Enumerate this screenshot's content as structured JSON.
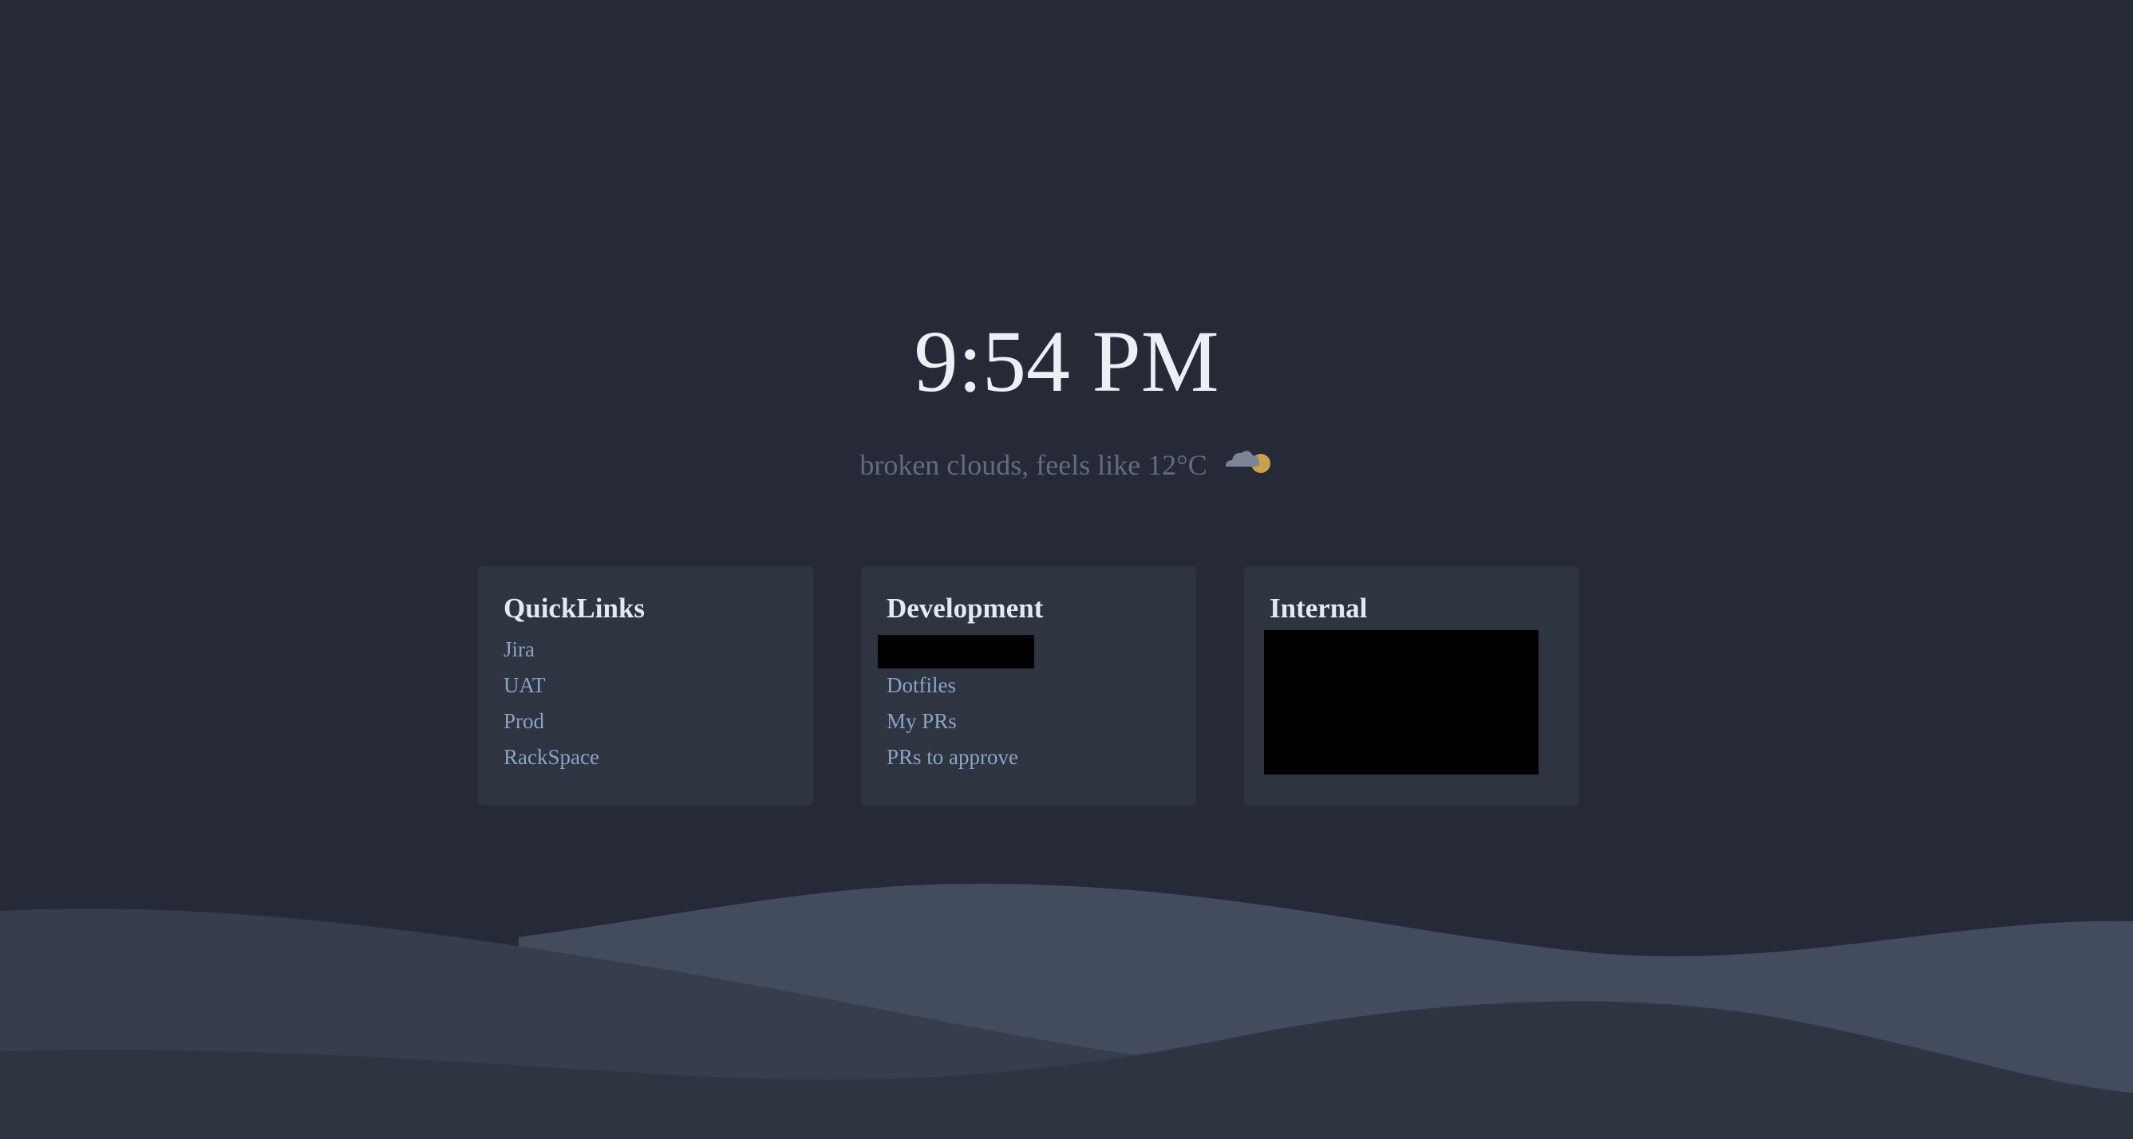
{
  "clock": {
    "time": "9:54 PM"
  },
  "weather": {
    "text": "broken clouds, feels like 12°C",
    "icon": "cloud-sun-icon"
  },
  "cards": [
    {
      "title": "QuickLinks",
      "links": [
        "Jira",
        "UAT",
        "Prod",
        "RackSpace"
      ]
    },
    {
      "title": "Development",
      "links": [
        "Dotfiles",
        "My PRs",
        "PRs to approve"
      ]
    },
    {
      "title": "Internal",
      "links": []
    }
  ],
  "colors": {
    "background": "#252a36",
    "card": "#2e3440",
    "text": "#eceff4",
    "muted": "#636b7c",
    "link": "#88a4c8",
    "wave_light": "#434c5e",
    "wave_mid": "#363d4c",
    "wave_dark": "#2e3440",
    "sun": "#c9a24a"
  }
}
